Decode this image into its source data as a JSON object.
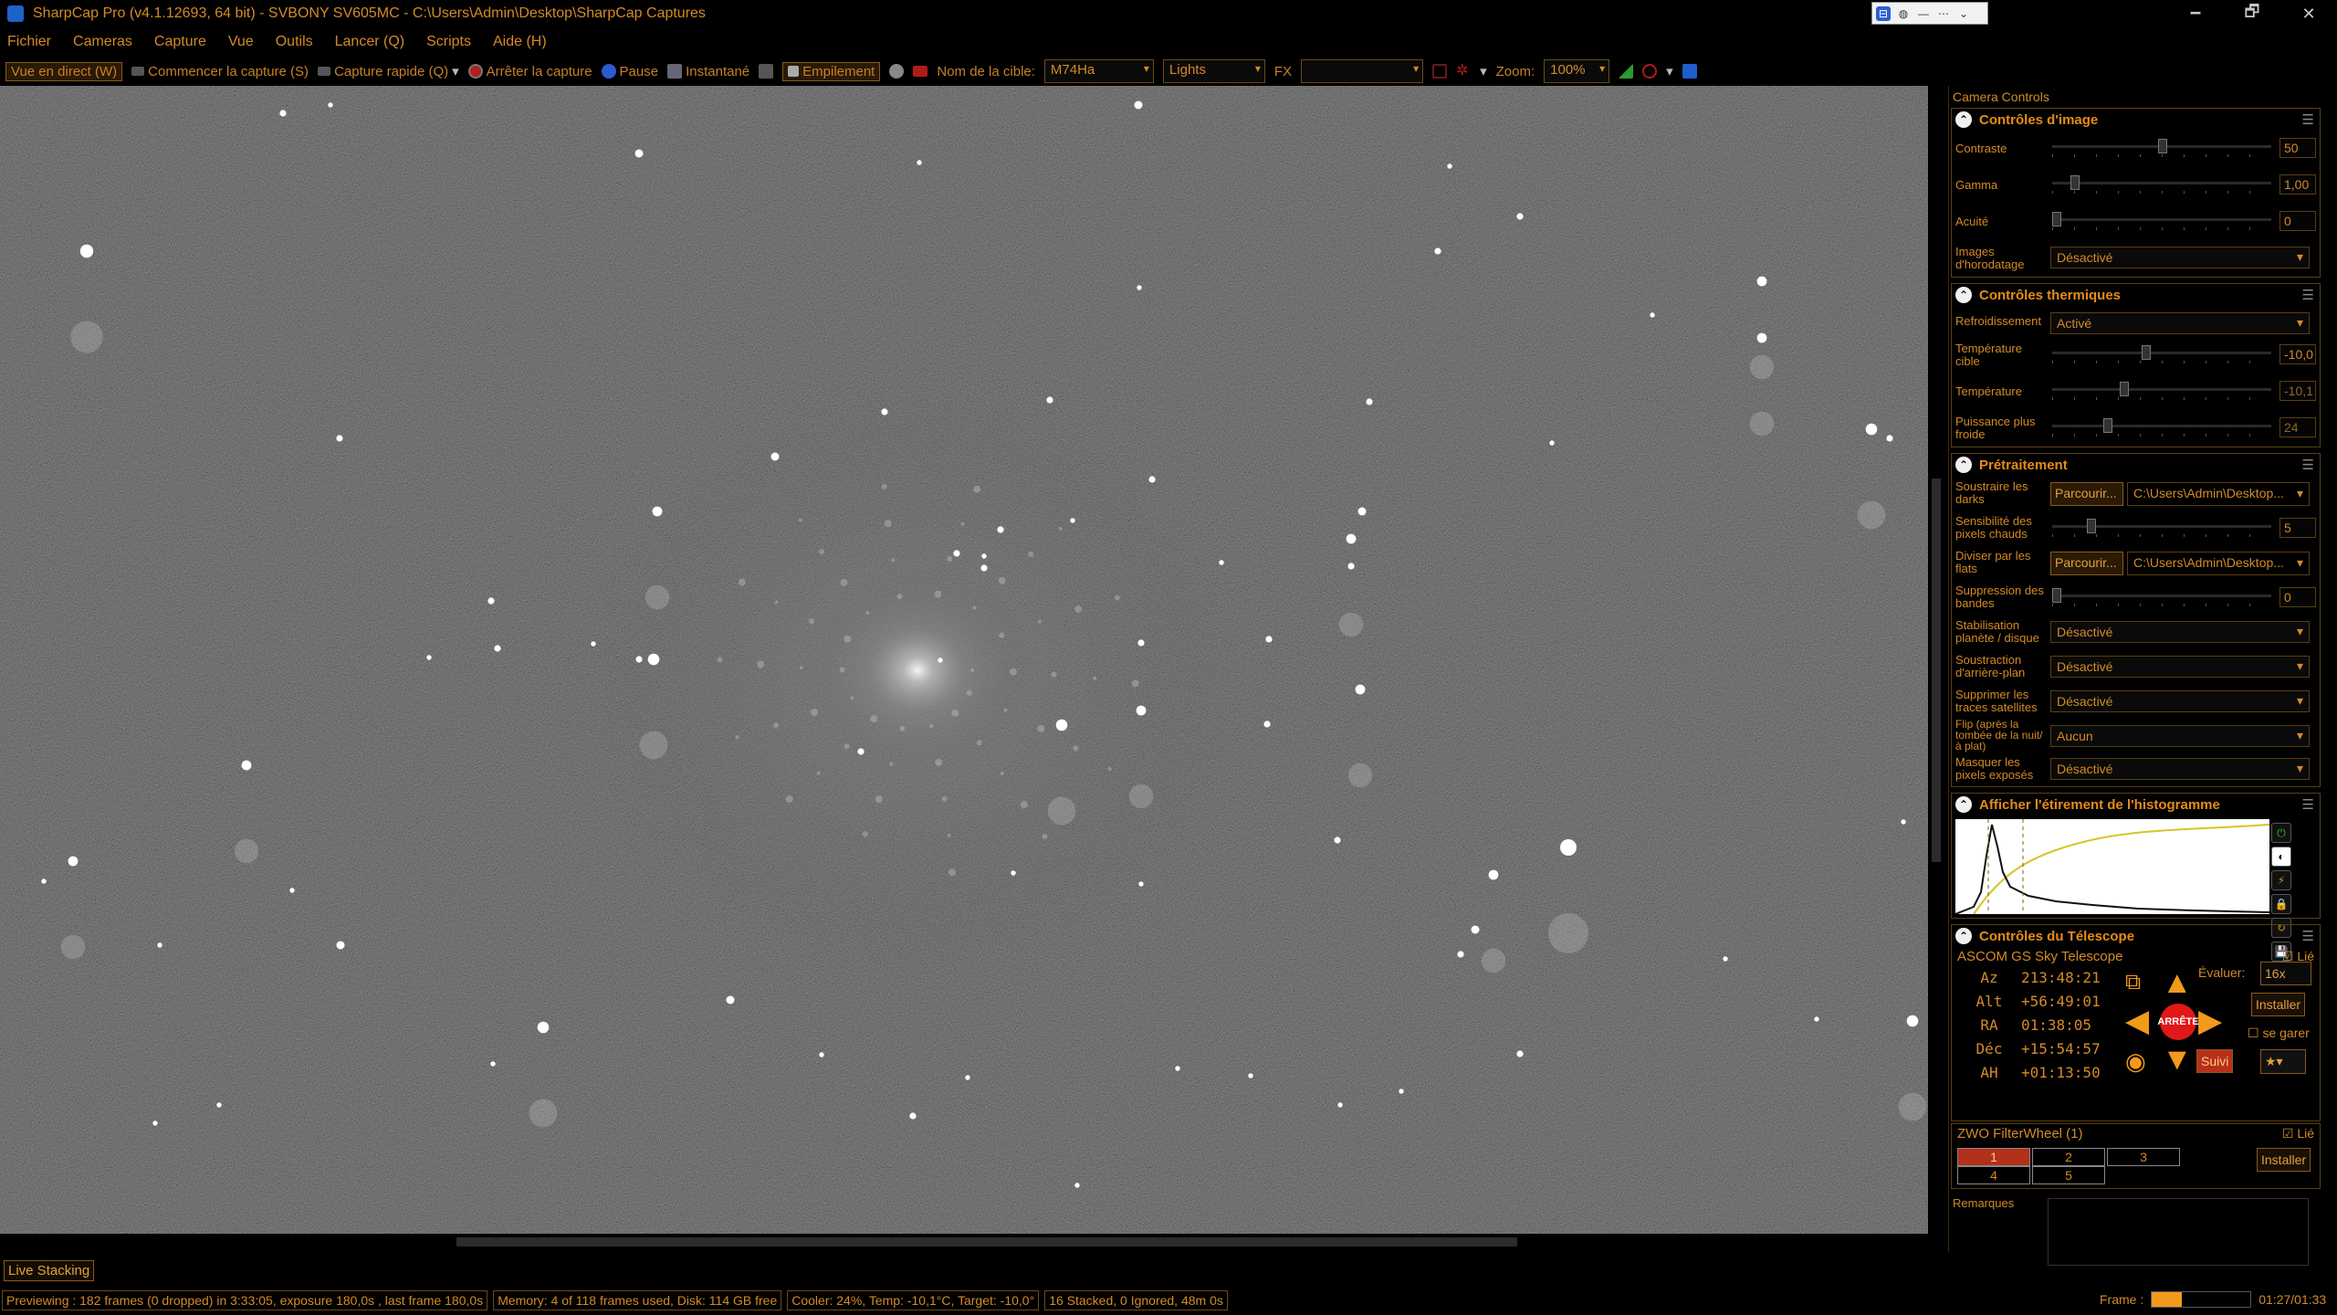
{
  "window": {
    "title": "SharpCap Pro (v4.1.12693, 64 bit) - SVBONY SV605MC - C:\\Users\\Admin\\Desktop\\SharpCap Captures",
    "controls": [
      "🗕",
      "🗗",
      "✕"
    ]
  },
  "menu": [
    "Fichier",
    "Cameras",
    "Capture",
    "Vue",
    "Outils",
    "Lancer (Q)",
    "Scripts",
    "Aide (H)"
  ],
  "toolbar": {
    "live_view": "Vue en direct (W)",
    "start_capture": "Commencer la capture (S)",
    "quick_capture": "Capture rapide (Q)",
    "stop_capture": "Arrêter la capture",
    "pause": "Pause",
    "snapshot": "Instantané",
    "stacking": "Empilement",
    "target_label": "Nom de la cible:",
    "target_value": "M74Ha",
    "frame_type": "Lights",
    "fx_label": "FX",
    "fx_value": "",
    "zoom_label": "Zoom:",
    "zoom_value": "100%"
  },
  "panel": {
    "header": "Camera Controls",
    "image_controls": {
      "title": "Contrôles d'image",
      "contrast_label": "Contraste",
      "contrast_value": "50",
      "gamma_label": "Gamma",
      "gamma_value": "1,00",
      "sharpness_label": "Acuité",
      "sharpness_value": "0",
      "timestamp_label": "Images d'horodatage",
      "timestamp_value": "Désactivé"
    },
    "thermal": {
      "title": "Contrôles thermiques",
      "cooling_label": "Refroidissement",
      "cooling_value": "Activé",
      "target_temp_label": "Température cible",
      "target_temp_value": "-10,0",
      "temp_label": "Température",
      "temp_value": "-10,1",
      "power_label": "Puissance plus froide",
      "power_value": "24"
    },
    "preprocessing": {
      "title": "Prétraitement",
      "darks_label": "Soustraire les darks",
      "browse": "Parcourir...",
      "darks_path": "C:\\Users\\Admin\\Desktop...",
      "hot_label": "Sensibilité des pixels chauds",
      "hot_value": "5",
      "flats_label": "Diviser par les flats",
      "flats_path": "C:\\Users\\Admin\\Desktop...",
      "banding_label": "Suppression des bandes",
      "banding_value": "0",
      "stab_label": "Stabilisation planète / disque",
      "stab_value": "Désactivé",
      "bg_label": "Soustraction d'arrière-plan",
      "bg_value": "Désactivé",
      "sat_label": "Supprimer les traces satellites",
      "sat_value": "Désactivé",
      "flip_label": "Flip (après la tombée de la nuit/à plat)",
      "flip_value": "Aucun",
      "mask_label": "Masquer les pixels exposés",
      "mask_value": "Désactivé"
    },
    "histogram": {
      "title": "Afficher l'étirement de l'histogramme"
    },
    "telescope": {
      "title": "Contrôles du Télescope",
      "name": "ASCOM GS Sky Telescope",
      "linked": "Lié",
      "coords": [
        {
          "k": "Az",
          "v": "213:48:21"
        },
        {
          "k": "Alt",
          "v": "+56:49:01"
        },
        {
          "k": "RA",
          "v": "01:38:05"
        },
        {
          "k": "Déc",
          "v": "+15:54:57"
        },
        {
          "k": "AH",
          "v": "+01:13:50"
        }
      ],
      "stop": "ARRÊTE",
      "rate_label": "Évaluer:",
      "rate_value": "16x",
      "install": "Installer",
      "park": "se garer",
      "track": "Suivi"
    },
    "filterwheel": {
      "name": "ZWO FilterWheel (1)",
      "linked": "Lié",
      "slots": [
        "1",
        "2",
        "3",
        "4",
        "5"
      ],
      "install": "Installer"
    },
    "remarks_label": "Remarques"
  },
  "bottom": {
    "live_stacking": "Live Stacking",
    "status1": "Previewing : 182 frames (0 dropped) in 3:33:05, exposure 180,0s , last frame 180,0s",
    "status2": "Memory: 4 of 118 frames used, Disk: 114 GB free",
    "status3": "Cooler: 24%, Temp: -10,1°C, Target: -10,0°",
    "status4": "16 Stacked, 0 Ignored, 48m 0s",
    "frame_label": "Frame :",
    "frame_progress": 0.3,
    "frame_time": "01:27/01:33"
  },
  "colors": {
    "accent": "#e58c18",
    "stop": "#e01818",
    "selected_filter": "#b3301a"
  }
}
